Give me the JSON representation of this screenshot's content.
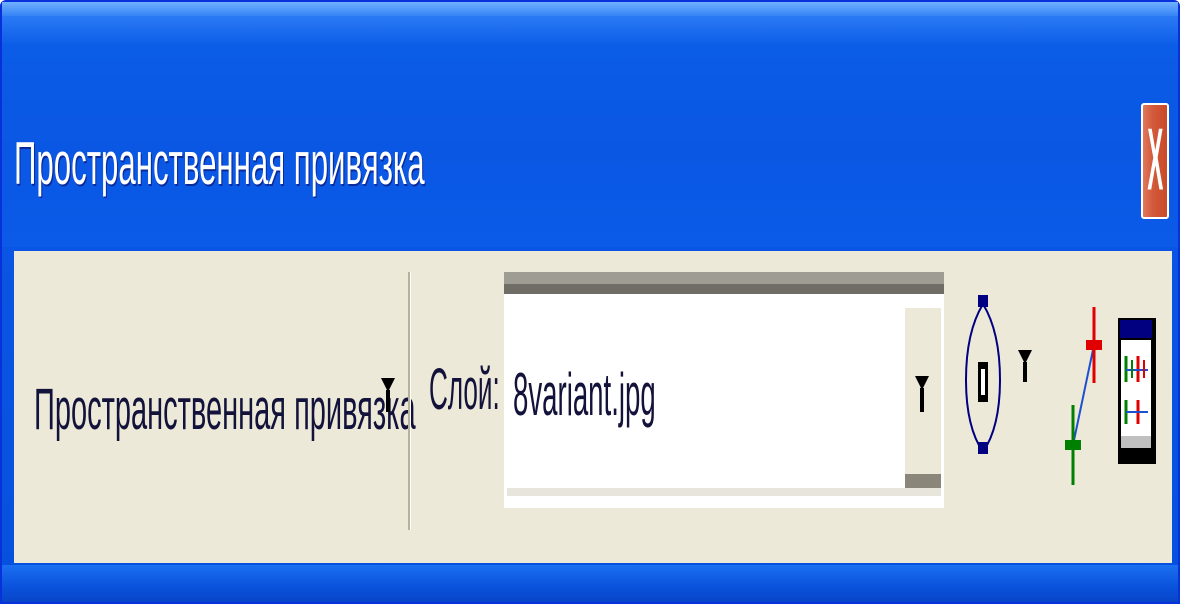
{
  "window": {
    "title": "Пространственная привязка",
    "close_label": "X"
  },
  "toolbar": {
    "menu_label": "Пространственная привязка",
    "layer_label": "Слой:",
    "layer_value": "8variant.jpg",
    "icons": [
      "menu-dropdown-icon",
      "layer-dropdown-icon",
      "control-point-icon",
      "control-point-dropdown-icon",
      "add-link-icon",
      "link-table-icon"
    ]
  },
  "colors": {
    "titlebar": "#0a57e4",
    "panel": "#ece9d8",
    "close_button": "#d25a3a",
    "link_red": "#e00000",
    "link_green": "#008000",
    "snap_blue": "#000080"
  }
}
